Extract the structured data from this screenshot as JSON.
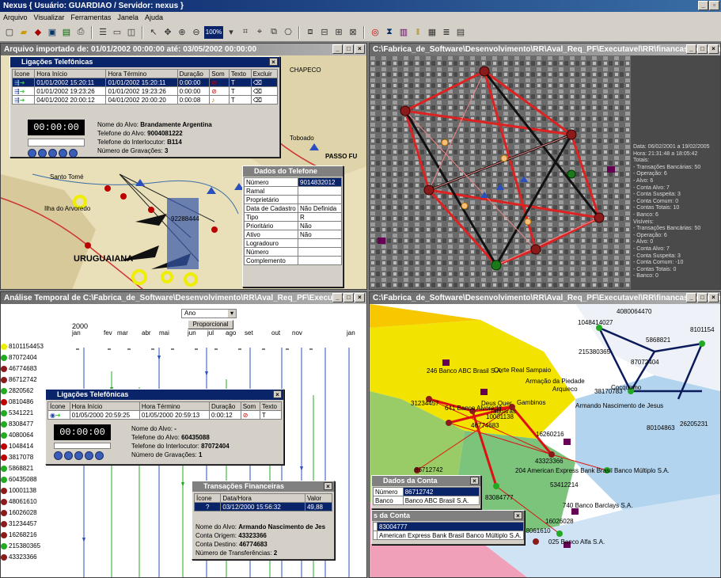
{
  "app": {
    "title": "Nexus { Usuário: GUARDIAO / Servidor: nexus }"
  },
  "menu": [
    "Arquivo",
    "Visualizar",
    "Ferramentas",
    "Janela",
    "Ajuda"
  ],
  "toolbar": {
    "zoom": "100%"
  },
  "win_map": {
    "title": "Arquivo importado de: 01/01/2002 00:00:00 até: 03/05/2002 00:00:00",
    "calls": {
      "title": "Ligações Telefônicas",
      "headers": [
        "Ícone",
        "Hora Início",
        "Hora Término",
        "Duração",
        "Som",
        "Texto",
        "Excluir"
      ],
      "rows": [
        [
          "01/01/2002 15:20:11",
          "01/01/2002 15:20:11",
          "0:00:00"
        ],
        [
          "01/01/2002 19:23:26",
          "01/01/2002 19:23:26",
          "0:00:00"
        ],
        [
          "04/01/2002 20:00:12",
          "04/01/2002 20:00:20",
          "0:00:08"
        ]
      ],
      "timer": "00:00:00",
      "info": {
        "alvo_label": "Nome do Alvo:",
        "alvo": "Brandamente Argentina",
        "tel_label": "Telefone do Alvo:",
        "tel": "9004081222",
        "interl_label": "Telefone do Interlocutor:",
        "interl": "B114",
        "grav_label": "Número de Gravações:",
        "grav": "3"
      }
    },
    "phone": {
      "title": "Dados do Telefone",
      "rows": [
        [
          "Número",
          "9014832012"
        ],
        [
          "Ramal",
          ""
        ],
        [
          "Proprietário",
          ""
        ],
        [
          "Data de Cadastro",
          "Não Definida"
        ],
        [
          "Tipo",
          "R"
        ],
        [
          "Prioritário",
          "Não"
        ],
        [
          "Ativo",
          "Não"
        ],
        [
          "Logradouro",
          ""
        ],
        [
          "Número",
          ""
        ],
        [
          "Complemento",
          ""
        ]
      ]
    },
    "places": [
      "CHAPECO",
      "Santo Tomé",
      "Ilha do Arvoredo",
      "URUGUAIANA",
      "PASSO FU",
      "92288444",
      "Toboado"
    ]
  },
  "win_photo": {
    "title": "C:\\Fabrica_de_Software\\Desenvolvimento\\RR\\Aval_Req_PF\\Executavel\\RR\\financas_pequeno.rr",
    "stats": [
      "Data: 06/02/2001 a 19/02/2005",
      "Hora: 21:31:48 a 18:05:42",
      "Totais:",
      "- Transações Bancárias: 50",
      "- Operação: 6",
      "- Alvo: 6",
      "- Conta Alvo: 7",
      "- Conta Suspeita: 3",
      "- Conta Comum: 0",
      "- Contas Totais: 10",
      "- Banco: 6",
      "Visíveis:",
      "- Transações Bancárias: 50",
      "- Operação: 6",
      "- Alvo: 0",
      "- Conta Alvo: 7",
      "- Conta Suspeita: 3",
      "- Conta Comum: -10",
      "- Contas Totais: 0",
      "- Banco: 0"
    ]
  },
  "win_time": {
    "title": "Análise Temporal de C:\\Fabrica_de_Software\\Desenvolvimento\\RR\\Aval_Req_PF\\Executavel\\R",
    "unit": "Ano",
    "prop": "Proporcional",
    "year": "2000",
    "months": [
      "jan",
      "fev",
      "mar",
      "abr",
      "mai",
      "jun",
      "jul",
      "ago",
      "set",
      "out",
      "nov",
      "jan"
    ],
    "ids": [
      "8101154453",
      "87072404",
      "46774683",
      "86712742",
      "2820562",
      "0810486",
      "5341221",
      "8308477",
      "4080064",
      "1048414",
      "3817078",
      "5868821",
      "60435088",
      "10001138",
      "48061610",
      "16026028",
      "31234457",
      "16268216",
      "215380365",
      "43323366"
    ],
    "calls": {
      "title": "Ligações Telefônicas",
      "headers": [
        "Ícone",
        "Hora Início",
        "Hora Término",
        "Duração",
        "Som",
        "Texto"
      ],
      "row": [
        "01/05/2000 20:59:25",
        "01/05/2000 20:59:13",
        "0:00:12"
      ],
      "timer": "00:00:00",
      "info": {
        "alvo_label": "Nome do Alvo:",
        "alvo": "-",
        "tel_label": "Telefone do Alvo:",
        "tel": "60435088",
        "interl_label": "Telefone do Interlocutor:",
        "interl": "87072404",
        "grav_label": "Número de Gravações:",
        "grav": "1"
      }
    },
    "trans": {
      "title": "Transações Financeiras",
      "headers": [
        "Ícone",
        "Data/Hora",
        "Valor"
      ],
      "row": [
        "03/12/2000 15:56:32",
        "49,88"
      ],
      "info": {
        "alvo_label": "Nome do Alvo:",
        "alvo": "Armando Nascimento de Jes",
        "orig_label": "Conta Origem:",
        "orig": "43323366",
        "dest_label": "Conta Destino:",
        "dest": "46774683",
        "n_label": "Número de Transferências:",
        "n": "2"
      }
    }
  },
  "win_net": {
    "title": "C:\\Fabrica_de_Software\\Desenvolvimento\\RR\\Aval_Req_PF\\Executavel\\RR\\financas_pequeno.rr - Ligações Telefônicas",
    "labels": [
      "4080064470",
      "1048414027",
      "215380365",
      "5868821",
      "87072404",
      "8101154",
      "246 Banco ABC Brasil S.A.",
      "Corte Real Sampaio",
      "Armação da Piedade",
      "Arquieco",
      "38170783",
      "Cocquinho",
      "Deus Quer",
      "Gambinos",
      "Taquaras",
      "31234457",
      "641 Banco Alvorada",
      "10001138",
      "46774683",
      "16260216",
      "Armando Nascimento de Jesus",
      "80104863",
      "26205231",
      "43323366",
      "204 American Express Bank Brasil Banco Múltiplo S.A.",
      "53412214",
      "86712742",
      "83084777",
      "740 Banco Barclays S.A.",
      "16026028",
      "48061610",
      "025 Banco Alfa S.A."
    ],
    "account": {
      "title": "Dados da Conta",
      "rows": [
        [
          "Número",
          "86712742"
        ],
        [
          "Banco",
          "Banco ABC Brasil S.A."
        ]
      ]
    },
    "account2": {
      "title": "s da Conta",
      "rows": [
        [
          "",
          "83004777"
        ],
        [
          "",
          "American Express Bank Brasil Banco Múltiplo S.A."
        ]
      ]
    }
  }
}
